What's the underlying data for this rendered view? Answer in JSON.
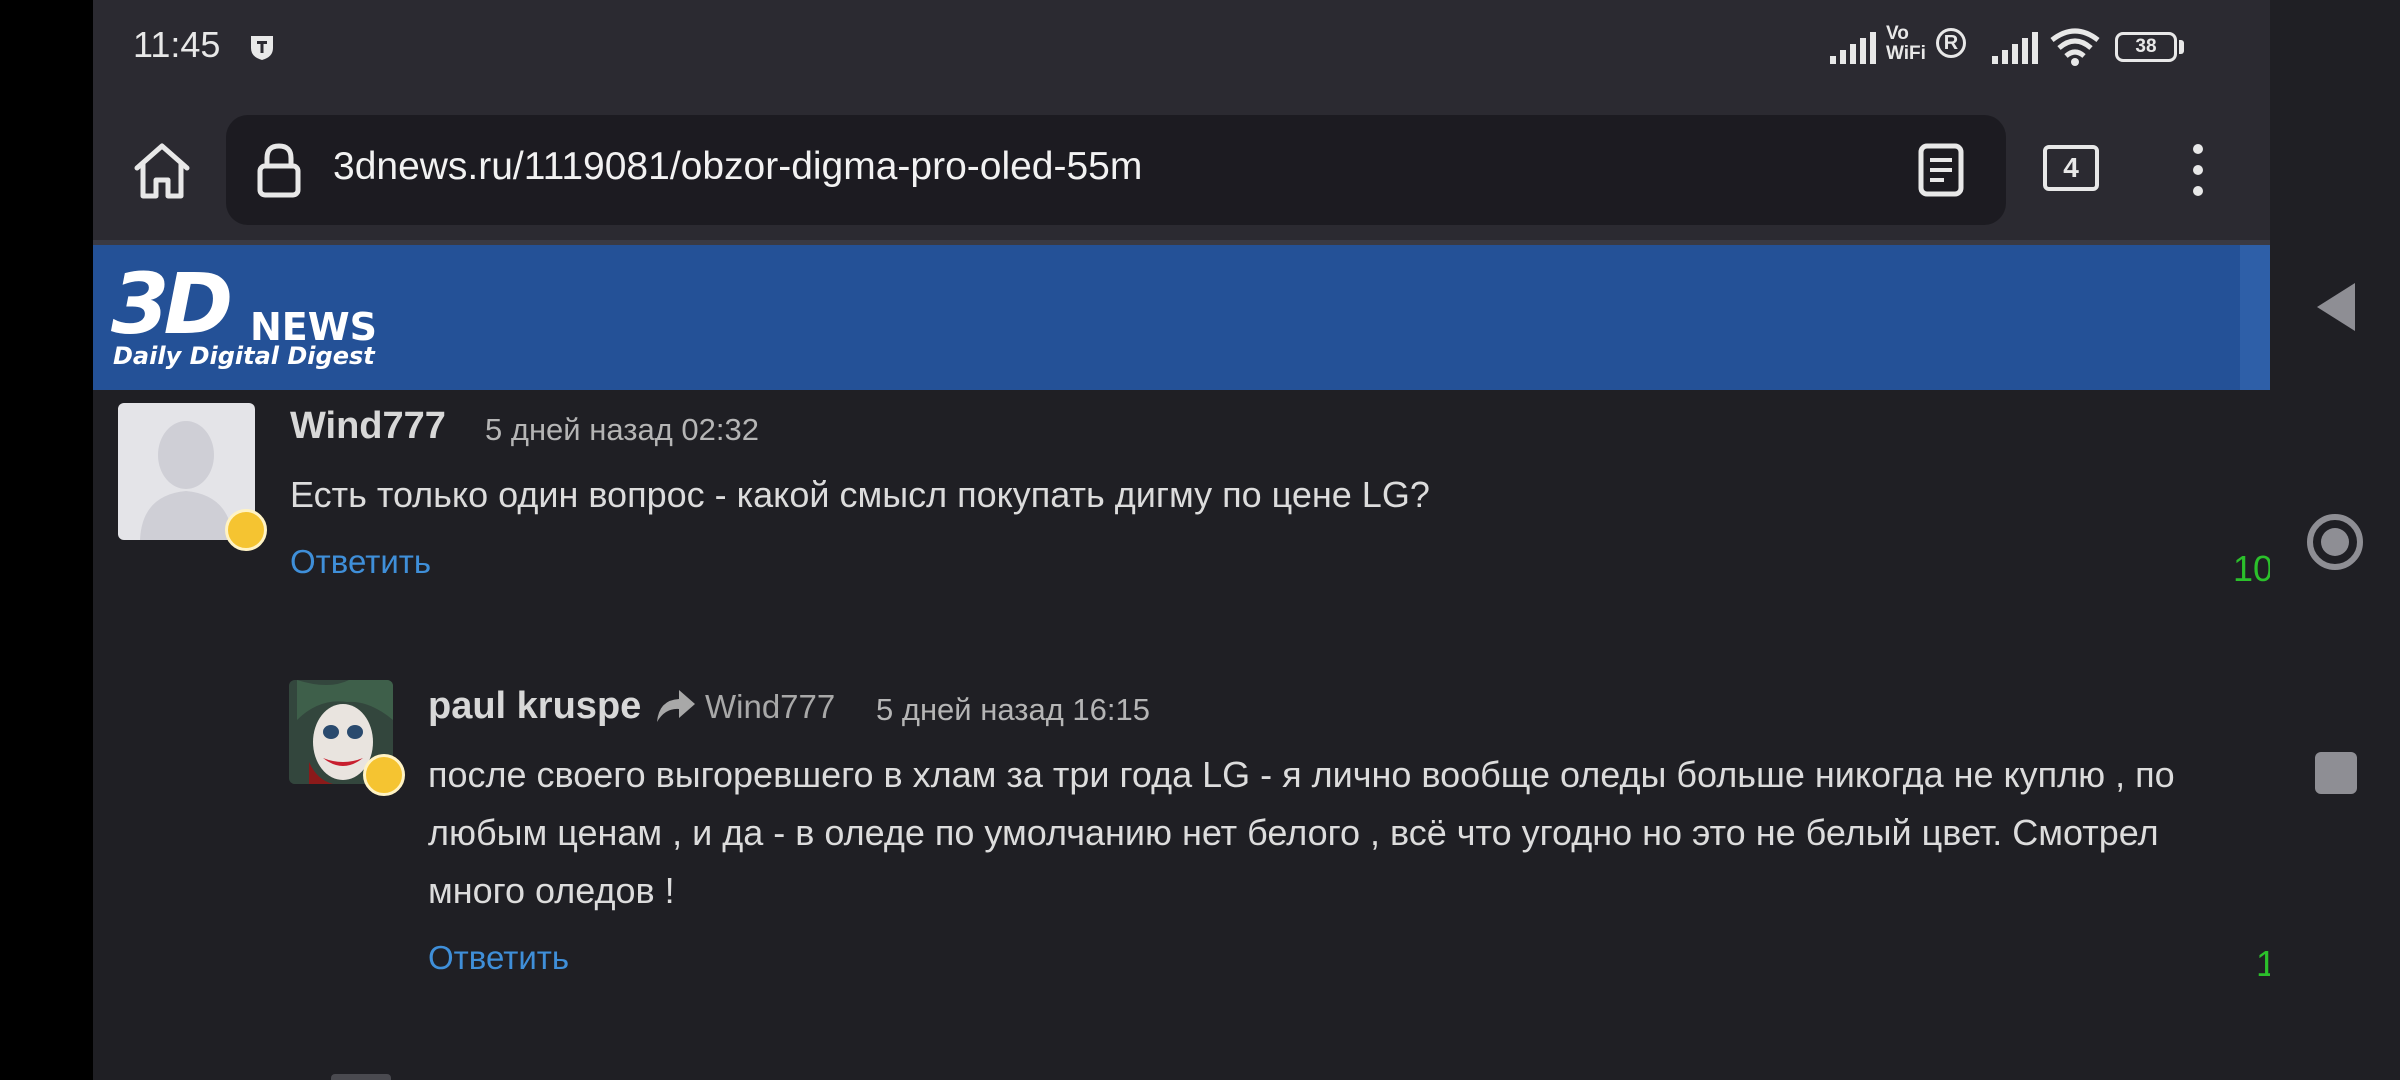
{
  "status": {
    "time": "11:45",
    "volte": "Vo WiFi",
    "roaming": "R",
    "battery": "38"
  },
  "browser": {
    "url": "3dnews.ru/1119081/obzor-digma-pro-oled-55m",
    "tab_count": "4"
  },
  "site": {
    "logo_main": "3D",
    "logo_news": "NEWS",
    "tagline": "Daily Digital Digest",
    "header_color": "#245197"
  },
  "comments": [
    {
      "author": "Wind777",
      "time": "5 дней назад 02:32",
      "text": "Есть только один вопрос - какой смысл покупать дигму по цене LG?",
      "reply_label": "Ответить",
      "score": "10"
    },
    {
      "author": "paul kruspe",
      "reply_to": "Wind777",
      "time": "5 дней назад 16:15",
      "text": "после своего выгоревшего в хлам за три года LG - я лично вообще оледы больше никогда не куплю , по любым ценам , и да - в оледе по умолчанию нет белого , всё что угодно но это не белый цвет. Смотрел много оледов !",
      "reply_label": "Ответить",
      "score": "1"
    }
  ],
  "colors": {
    "link": "#3f8fd9",
    "score": "#2bc02b",
    "background": "#1f1f24"
  }
}
